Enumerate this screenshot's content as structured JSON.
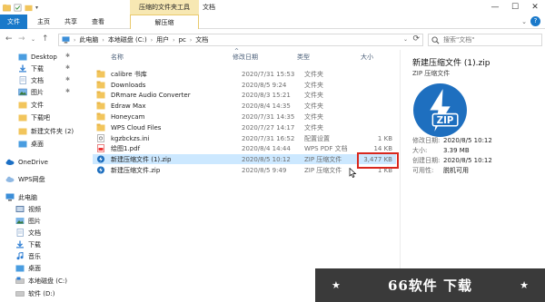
{
  "window": {
    "context_tool_label": "压缩的文件夹工具",
    "title": "文档",
    "controls": {
      "minimize": "—",
      "maximize": "☐",
      "close": "✕"
    }
  },
  "ribbon": {
    "tabs": {
      "file": "文件",
      "home": "主页",
      "share": "共享",
      "view": "查看",
      "extract": "解压缩"
    },
    "expand": "⌄",
    "help": "?"
  },
  "nav_buttons": {
    "back": "←",
    "forward": "→",
    "recent": "⌄",
    "up": "↑"
  },
  "address": {
    "crumbs": [
      "此电脑",
      "本地磁盘 (C:)",
      "用户",
      "pc",
      "文档"
    ],
    "separator": "›",
    "dropdown": "⌄",
    "refresh": "⟳"
  },
  "search": {
    "placeholder": "搜索\"文档\""
  },
  "navpane": {
    "quick": [
      {
        "label": "Desktop",
        "icon": "folder-blue-icon",
        "pinned": true
      },
      {
        "label": "下载",
        "icon": "download-icon",
        "pinned": true
      },
      {
        "label": "文档",
        "icon": "document-icon",
        "pinned": true
      },
      {
        "label": "图片",
        "icon": "pictures-icon",
        "pinned": true
      },
      {
        "label": "文件",
        "icon": "folder-icon",
        "pinned": false
      },
      {
        "label": "下载吧",
        "icon": "folder-icon",
        "pinned": false
      },
      {
        "label": "新建文件夹 (2)",
        "icon": "folder-icon",
        "pinned": false
      },
      {
        "label": "桌面",
        "icon": "folder-blue-icon",
        "pinned": false
      }
    ],
    "onedrive": "OneDrive",
    "wps": "WPS网盘",
    "thispc": "此电脑",
    "pc_items": [
      {
        "label": "视频",
        "icon": "video-icon"
      },
      {
        "label": "图片",
        "icon": "pictures-icon"
      },
      {
        "label": "文档",
        "icon": "document-icon"
      },
      {
        "label": "下载",
        "icon": "download-icon"
      },
      {
        "label": "音乐",
        "icon": "music-icon"
      },
      {
        "label": "桌面",
        "icon": "desktop-icon"
      },
      {
        "label": "本地磁盘 (C:)",
        "icon": "drive-icon"
      },
      {
        "label": "软件 (D:)",
        "icon": "drive-icon"
      }
    ]
  },
  "columns": {
    "name": "名称",
    "date": "修改日期",
    "type": "类型",
    "size": "大小",
    "sort_indicator": "^"
  },
  "files": [
    {
      "name": "calibre 书库",
      "date": "2020/7/31 15:53",
      "type": "文件夹",
      "size": "",
      "icon": "folder-icon"
    },
    {
      "name": "Downloads",
      "date": "2020/8/5 9:24",
      "type": "文件夹",
      "size": "",
      "icon": "folder-icon"
    },
    {
      "name": "DRmare Audio Converter",
      "date": "2020/8/3 15:21",
      "type": "文件夹",
      "size": "",
      "icon": "folder-icon"
    },
    {
      "name": "Edraw Max",
      "date": "2020/8/4 14:35",
      "type": "文件夹",
      "size": "",
      "icon": "folder-icon"
    },
    {
      "name": "Honeycam",
      "date": "2020/7/31 14:35",
      "type": "文件夹",
      "size": "",
      "icon": "folder-icon"
    },
    {
      "name": "WPS Cloud Files",
      "date": "2020/7/27 14:17",
      "type": "文件夹",
      "size": "",
      "icon": "folder-icon"
    },
    {
      "name": "kgzbckzs.ini",
      "date": "2020/7/31 16:52",
      "type": "配置设置",
      "size": "1 KB",
      "icon": "ini-icon"
    },
    {
      "name": "绘图1.pdf",
      "date": "2020/8/4 14:44",
      "type": "WPS PDF 文档",
      "size": "14 KB",
      "icon": "pdf-icon"
    },
    {
      "name": "新建压缩文件 (1).zip",
      "date": "2020/8/5 10:12",
      "type": "ZIP 压缩文件",
      "size": "3,477 KB",
      "icon": "zip-icon",
      "selected": true
    },
    {
      "name": "新建压缩文件.zip",
      "date": "2020/8/5 9:49",
      "type": "ZIP 压缩文件",
      "size": "1 KB",
      "icon": "zip-icon"
    }
  ],
  "preview": {
    "title": "新建压缩文件 (1).zip",
    "subtitle": "ZIP 压缩文件",
    "zip_label": "ZIP",
    "props": [
      {
        "k": "修改日期:",
        "v": "2020/8/5 10:12"
      },
      {
        "k": "大小:",
        "v": "3.39 MB"
      },
      {
        "k": "创建日期:",
        "v": "2020/8/5 10:12"
      },
      {
        "k": "可用性:",
        "v": "脱机可用"
      }
    ]
  },
  "watermark": {
    "text": "66软件 下载",
    "star": "★"
  },
  "colors": {
    "accent": "#1979ca",
    "selection": "#cce8ff",
    "highlight_box": "#d9281e",
    "context_tab": "#f7e8b3"
  }
}
